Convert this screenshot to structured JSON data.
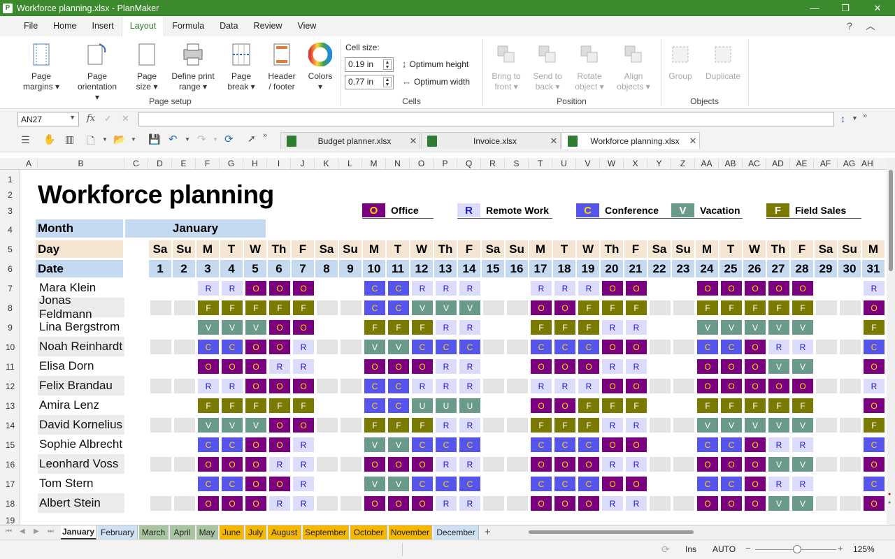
{
  "window": {
    "title": "Workforce planning.xlsx - PlanMaker",
    "app_icon": "P"
  },
  "menu": [
    "File",
    "Home",
    "Insert",
    "Layout",
    "Formula",
    "Data",
    "Review",
    "View"
  ],
  "menu_active": "Layout",
  "ribbon": {
    "page_setup": {
      "label": "Page setup",
      "buttons": [
        {
          "l1": "Page",
          "l2": "margins ▾"
        },
        {
          "l1": "Page",
          "l2": "orientation ▾"
        },
        {
          "l1": "Page",
          "l2": "size ▾"
        },
        {
          "l1": "Define print",
          "l2": "range ▾"
        },
        {
          "l1": "Page",
          "l2": "break ▾"
        },
        {
          "l1": "Header",
          "l2": "/ footer"
        },
        {
          "l1": "Colors",
          "l2": "▾"
        }
      ]
    },
    "cells": {
      "label": "Cells",
      "cell_size_label": "Cell size:",
      "height_value": "0.19 in",
      "width_value": "0.77 in",
      "opt_height": "Optimum height",
      "opt_width": "Optimum width"
    },
    "position": {
      "label": "Position",
      "buttons": [
        {
          "l1": "Bring to",
          "l2": "front ▾"
        },
        {
          "l1": "Send to",
          "l2": "back ▾"
        },
        {
          "l1": "Rotate",
          "l2": "object ▾"
        },
        {
          "l1": "Align",
          "l2": "objects ▾"
        }
      ]
    },
    "objects": {
      "label": "Objects",
      "buttons": [
        {
          "l1": "Group"
        },
        {
          "l1": "Duplicate"
        }
      ]
    }
  },
  "formula": {
    "cell_ref": "AN27",
    "fx": "fx",
    "value": ""
  },
  "doc_tabs": [
    {
      "name": "Budget planner.xlsx",
      "active": false
    },
    {
      "name": "Invoice.xlsx",
      "active": false
    },
    {
      "name": "Workforce planning.xlsx",
      "active": true
    }
  ],
  "columns": [
    "A",
    "B",
    "C",
    "D",
    "E",
    "F",
    "G",
    "H",
    "I",
    "J",
    "K",
    "L",
    "M",
    "N",
    "O",
    "P",
    "Q",
    "R",
    "S",
    "T",
    "U",
    "V",
    "W",
    "X",
    "Y",
    "Z",
    "AA",
    "AB",
    "AC",
    "AD",
    "AE",
    "AF",
    "AG",
    "AH"
  ],
  "rows": [
    "1",
    "2",
    "3",
    "4",
    "5",
    "6",
    "7",
    "8",
    "9",
    "10",
    "11",
    "12",
    "13",
    "14",
    "15",
    "16",
    "17",
    "18",
    "19"
  ],
  "sheet": {
    "title": "Workforce planning",
    "month_label": "Month",
    "month_value": "January",
    "day_label": "Day",
    "date_label": "Date",
    "legend": [
      {
        "code": "O",
        "label": "Office",
        "bg": "#7a0080",
        "fg": "#ffd700"
      },
      {
        "code": "R",
        "label": "Remote Work",
        "bg": "#dcdcfa",
        "fg": "#1a1acc"
      },
      {
        "code": "C",
        "label": "Conference",
        "bg": "#5555ee",
        "fg": "#ffd700"
      },
      {
        "code": "V",
        "label": "Vacation",
        "bg": "#6a9a8a",
        "fg": "#ffffff"
      },
      {
        "code": "F",
        "label": "Field Sales",
        "bg": "#7a7a00",
        "fg": "#ffffff"
      }
    ],
    "days": [
      "Sa",
      "Su",
      "M",
      "T",
      "W",
      "Th",
      "F",
      "Sa",
      "Su",
      "M",
      "T",
      "W",
      "Th",
      "F",
      "Sa",
      "Su",
      "M",
      "T",
      "W",
      "Th",
      "F",
      "Sa",
      "Su",
      "M",
      "T",
      "W",
      "Th",
      "F",
      "Sa",
      "Su",
      "M"
    ],
    "dates": [
      "1",
      "2",
      "3",
      "4",
      "5",
      "6",
      "7",
      "8",
      "9",
      "10",
      "11",
      "12",
      "13",
      "14",
      "15",
      "16",
      "17",
      "18",
      "19",
      "20",
      "21",
      "22",
      "23",
      "24",
      "25",
      "26",
      "27",
      "28",
      "29",
      "30",
      "31"
    ],
    "employees": [
      {
        "name": "Mara Klein",
        "sched": "..RROOO..CCRRR..RRROO..OOOOO..R"
      },
      {
        "name": "Jonas Feldmann",
        "sched": "..FFFFF..CCVVV..OOFFF..FFFFF..O"
      },
      {
        "name": "Lina Bergstrom",
        "sched": "..VVVOO..FFFRR..FFFRR..VVVVV..F"
      },
      {
        "name": "Noah Reinhardt",
        "sched": "..CCOOR..VVCCC..CCCOO..CCORR..C"
      },
      {
        "name": "Elisa Dorn",
        "sched": "..OOORR..OOORR..OOORR..OOOVV..O"
      },
      {
        "name": "Felix Brandau",
        "sched": "..RROOO..CCRRR..RRROO..OOOOO..R"
      },
      {
        "name": "Amira Lenz",
        "sched": "..FFFFF..CCUUU..OOFFF..FFFFF..O"
      },
      {
        "name": "David Kornelius",
        "sched": "..VVVOO..FFFRR..FFFRR..VVVVV..F"
      },
      {
        "name": "Sophie Albrecht",
        "sched": "..CCOOR..VVCCC..CCCOO..CCORR..C"
      },
      {
        "name": "Leonhard Voss",
        "sched": "..OOORR..OOORR..OOORR..OOOVV..O"
      },
      {
        "name": "Tom Stern",
        "sched": "..CCOOR..VVCCC..CCCOO..CCORR..C"
      },
      {
        "name": "Albert Stein",
        "sched": "..OOORR..OOORR..OOORR..OOOVV..O"
      }
    ]
  },
  "sheet_tabs": [
    {
      "name": "January",
      "color": "#ffffff",
      "active": true
    },
    {
      "name": "February",
      "color": "#cfe2f3"
    },
    {
      "name": "March",
      "color": "#a9c4a0"
    },
    {
      "name": "April",
      "color": "#a9c4a0"
    },
    {
      "name": "May",
      "color": "#a9c4a0"
    },
    {
      "name": "June",
      "color": "#f5b800"
    },
    {
      "name": "July",
      "color": "#f5b800"
    },
    {
      "name": "August",
      "color": "#f5b800"
    },
    {
      "name": "September",
      "color": "#f5b800"
    },
    {
      "name": "October",
      "color": "#f5b800"
    },
    {
      "name": "November",
      "color": "#f5b800"
    },
    {
      "name": "December",
      "color": "#cfe2f3"
    }
  ],
  "status": {
    "ins": "Ins",
    "mode": "AUTO",
    "zoom": "125%"
  },
  "colors": {
    "accent": "#3c8a2e",
    "header_blue": "#c5d9f1",
    "header_beige": "#f5e6d3",
    "weekend": "#e4e4e4",
    "unplanned": "#6a9a8a"
  }
}
